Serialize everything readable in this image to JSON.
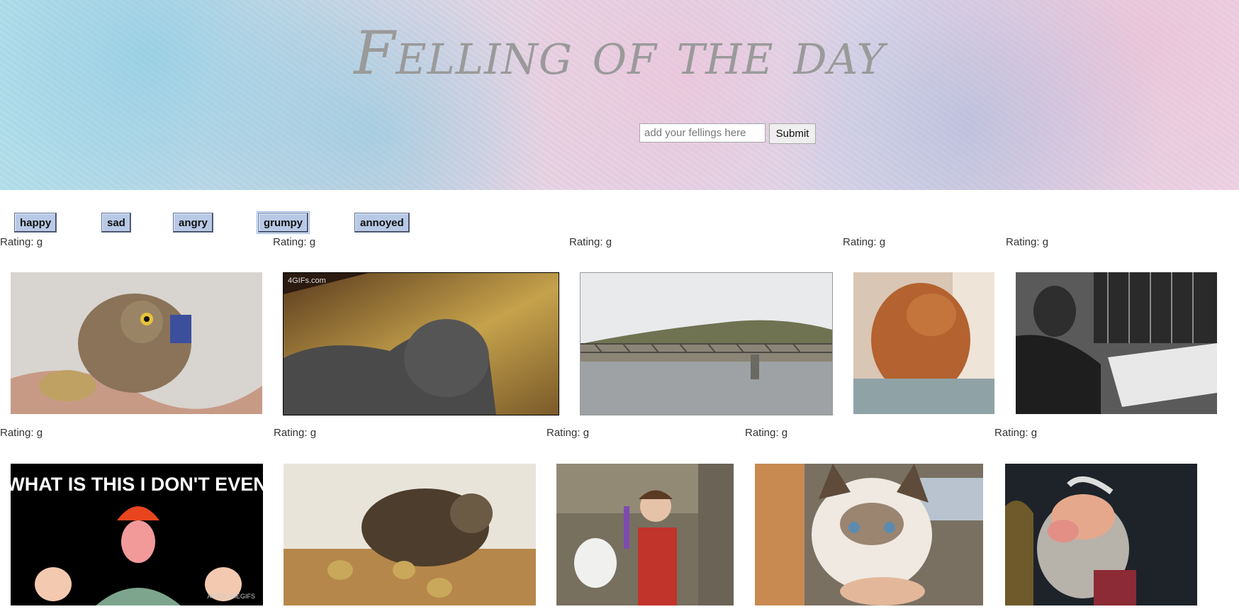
{
  "header": {
    "title": "Felling of the day",
    "input_placeholder": "add your fellings here",
    "submit_label": "Submit"
  },
  "mood_buttons": [
    "happy",
    "sad",
    "angry",
    "grumpy",
    "annoyed"
  ],
  "rows": [
    {
      "ratings": [
        "Rating: g",
        "Rating: g",
        "Rating: g",
        "Rating: g",
        "Rating: g"
      ]
    },
    {
      "ratings": [
        "Rating: g",
        "Rating: g",
        "Rating: g",
        "Rating: g",
        "Rating: g"
      ]
    }
  ],
  "gif_captions": {
    "meme": "WHAT IS THIS I DON'T EVEN",
    "meme_watermark": "AWESOMEGIFS",
    "cat_watermark": "4GIFs.com"
  }
}
